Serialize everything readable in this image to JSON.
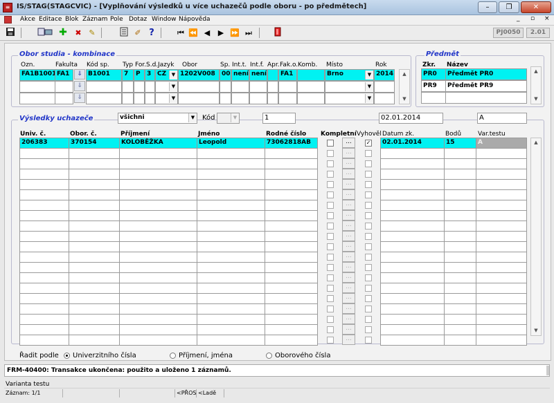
{
  "window": {
    "title": "IS/STAG(STAGCVIC) - [Vyplňování výsledků u více uchazečů podle oboru - po předmětech]",
    "min": "–",
    "restore": "❐",
    "close": "✕",
    "doc_min": "_",
    "doc_restore": "▫",
    "doc_close": "×",
    "form_id": "PJ0050",
    "version": "2.01"
  },
  "menu": [
    "Akce",
    "Editace",
    "Blok",
    "Záznam",
    "Pole",
    "Dotaz",
    "Window",
    "Nápověda"
  ],
  "toolbar_icons": [
    "save-icon",
    "print-icon",
    "insert-record-icon",
    "delete-record-icon",
    "clear-icon",
    "list-icon",
    "edit-icon",
    "help-icon",
    "first-icon",
    "prev-block-icon",
    "prev-record-icon",
    "next-record-icon",
    "next-block-icon",
    "last-icon",
    "exit-icon"
  ],
  "obor_section": {
    "legend": "Obor studia - kombinace",
    "headers": [
      "Ozn.",
      "Fakulta",
      "Kód sp.",
      "Typ",
      "For.",
      "S.d.",
      "Jazyk",
      "Obor",
      "Sp.",
      "Int.t.",
      "Int.f.",
      "Apr.",
      "Fak.o.",
      "Komb.",
      "Místo",
      "Rok"
    ],
    "row": {
      "ozn": "FA1B1001",
      "fakulta": "FA1",
      "kod_sp": "B1001",
      "typ": "7",
      "forma": "P",
      "sd": "3",
      "jazyk": "CZ",
      "obor": "1202V008",
      "sp": "00",
      "intt": "není",
      "intf": "není",
      "apr": "",
      "fako": "FA1",
      "komb": "",
      "misto": "Brno",
      "rok": "2014"
    },
    "download_arrow": "⇓"
  },
  "predmet_section": {
    "legend": "Předmět",
    "headers": [
      "Zkr.",
      "Název"
    ],
    "rows": [
      {
        "zkr": "PR0",
        "nazev": "Předmět PR0"
      },
      {
        "zkr": "PR9",
        "nazev": "Předmět PR9"
      }
    ]
  },
  "results_filter": {
    "legend": "Výsledky uchazeče",
    "filter_select": "všichni",
    "kod_label": "Kód",
    "kod_value": "",
    "count_value": "1",
    "date_value": "02.01.2014",
    "var_value": "A"
  },
  "results_table": {
    "headers": [
      "Univ. č.",
      "Obor. č.",
      "Příjmení",
      "Jméno",
      "Rodné číslo",
      "Kompletní",
      "Vyhověl",
      "Datum zk.",
      "Bodů",
      "Var.testu"
    ],
    "rows": [
      {
        "univ": "206383",
        "obor": "370154",
        "prijmeni": "KOLOBĚŽKA",
        "jmeno": "Leopold",
        "rc": "73062818AB",
        "kompletni": false,
        "vyhovel": true,
        "datum": "02.01.2014",
        "body": "15",
        "var": "A"
      }
    ],
    "empty_rows": 19,
    "dots_label": "..."
  },
  "sort": {
    "label": "Řadit podle",
    "options": [
      {
        "label": "Univerzitního čísla",
        "selected": true
      },
      {
        "label": "Příjmení, jména",
        "selected": false
      },
      {
        "label": "Oborového čísla",
        "selected": false
      }
    ]
  },
  "message": "FRM-40400: Transakce ukončena: použito a uloženo 1 záznamů.",
  "status": {
    "hint": "Varianta testu",
    "record": "Záznam: 1/1",
    "pros": "<PŘOS",
    "lade": "<Ladě"
  }
}
